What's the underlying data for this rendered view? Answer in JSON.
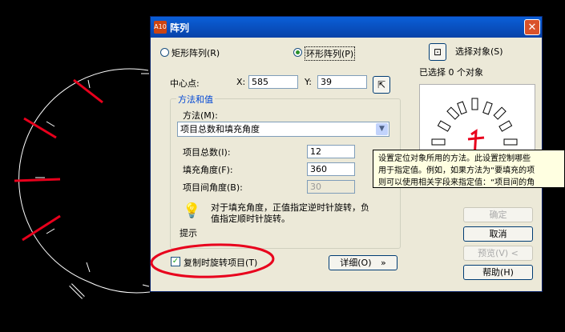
{
  "dialog": {
    "title": "阵列",
    "title_icon": "A10",
    "close": "✕",
    "rect_array_label": "矩形阵列(R)",
    "polar_array_label": "环形阵列(P)",
    "center_label": "中心点:",
    "x_label": "X:",
    "x_value": "585",
    "y_label": "Y:",
    "y_value": "39",
    "method_group_title": "方法和值",
    "method_label": "方法(M):",
    "method_value": "项目总数和填充角度",
    "total_items_label": "项目总数(I):",
    "total_items_value": "12",
    "fill_angle_label": "填充角度(F):",
    "fill_angle_value": "360",
    "angle_between_label": "项目间角度(B):",
    "angle_between_value": "30",
    "tip_text_line1": "对于填充角度，正值指定逆时针旋转，负",
    "tip_text_line2": "值指定顺时针旋转。",
    "tip_label": "提示",
    "rotate_items_label": "复制时旋转项目(T)",
    "rotate_items_checked": true,
    "details_label": "详细(O)",
    "details_chevron": "»",
    "select_objects_label": "选择对象(S)",
    "selected_count_text": "已选择 0 个对象",
    "ok_label": "确定",
    "cancel_label": "取消",
    "preview_label": "预览(V) <",
    "help_label": "帮助(H)"
  },
  "tooltip": {
    "line1": "设置定位对象所用的方法。此设置控制哪些",
    "line2": "用于指定值。例如，如果方法为“要填充的项",
    "line3": "则可以使用相关字段来指定值：“项目间的角"
  },
  "colors": {
    "annotation": "#e8001c",
    "titlebar": "#0a5fd8"
  }
}
